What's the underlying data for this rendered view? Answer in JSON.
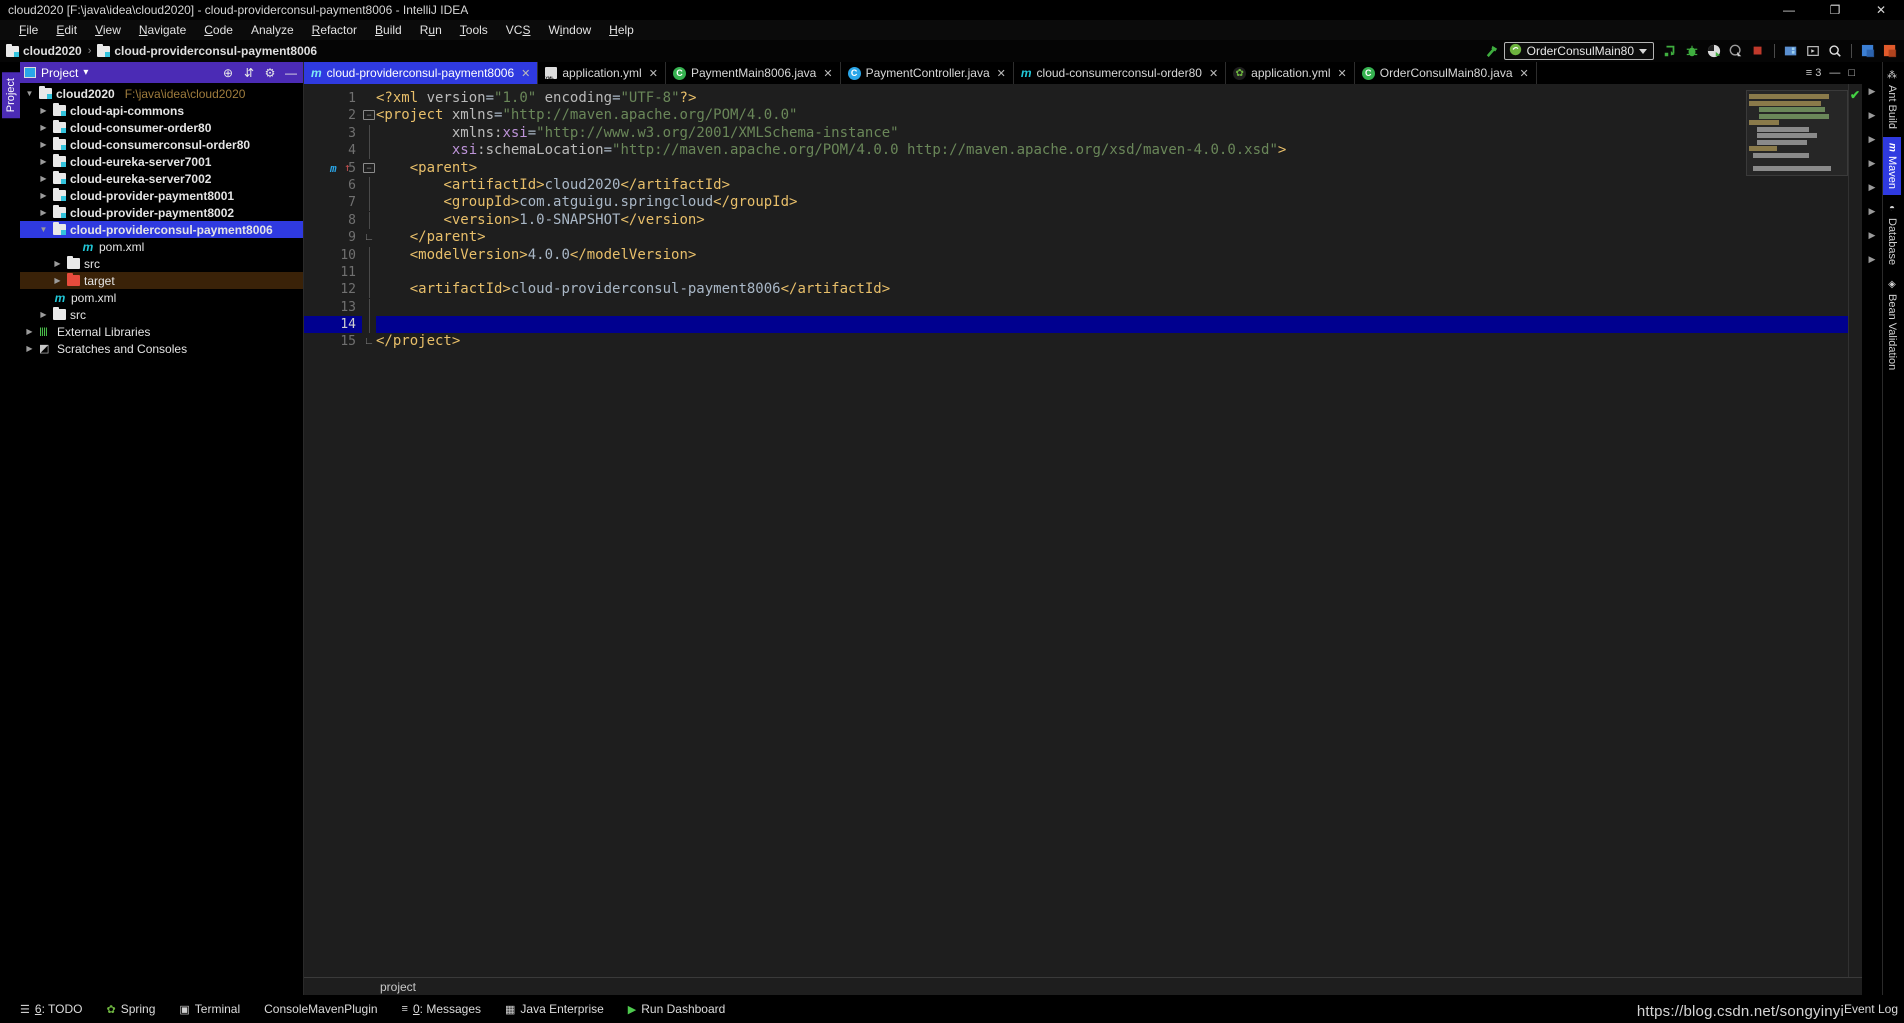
{
  "window": {
    "title": "cloud2020 [F:\\java\\idea\\cloud2020] - cloud-providerconsul-payment8006 - IntelliJ IDEA",
    "minimize": "—",
    "maximize": "❐",
    "close": "✕"
  },
  "menu": {
    "items": [
      {
        "label": "File"
      },
      {
        "label": "Edit"
      },
      {
        "label": "View"
      },
      {
        "label": "Navigate"
      },
      {
        "label": "Code"
      },
      {
        "label": "Analyze"
      },
      {
        "label": "Refactor"
      },
      {
        "label": "Build"
      },
      {
        "label": "Run"
      },
      {
        "label": "Tools"
      },
      {
        "label": "VCS"
      },
      {
        "label": "Window"
      },
      {
        "label": "Help"
      }
    ]
  },
  "navbar": {
    "breadcrumb": [
      {
        "label": "cloud2020",
        "icon": "module-folder-icon"
      },
      {
        "label": "cloud-providerconsul-payment8006",
        "icon": "module-folder-icon"
      }
    ],
    "separator": "›",
    "run_config": {
      "name": "OrderConsulMain80",
      "icon": "spring-boot-icon"
    },
    "actions": [
      {
        "name": "hammer-build-icon",
        "glyph": "↖"
      },
      {
        "name": "run-icon",
        "glyph": "▶"
      },
      {
        "name": "debug-icon",
        "glyph": "ὁE"
      },
      {
        "name": "run-coverage-icon",
        "glyph": "◐"
      },
      {
        "name": "profile-icon",
        "glyph": "◔"
      },
      {
        "name": "stop-icon",
        "glyph": "■"
      },
      {
        "name": "update-project-icon",
        "glyph": "▣"
      },
      {
        "name": "commit-icon",
        "glyph": "▷"
      },
      {
        "name": "search-everywhere-icon",
        "glyph": "⌕"
      },
      {
        "name": "vcs-history-icon",
        "glyph": "⧉"
      },
      {
        "name": "vcs-rollback-icon",
        "glyph": "↺"
      }
    ]
  },
  "project_panel": {
    "title": "Project",
    "dropdown_caret": "▾",
    "header_actions": [
      {
        "name": "locate-icon",
        "glyph": "⊕"
      },
      {
        "name": "collapse-all-icon",
        "glyph": "⇵"
      },
      {
        "name": "settings-gear-icon",
        "glyph": "⚙"
      },
      {
        "name": "hide-icon",
        "glyph": "—"
      }
    ],
    "side_tab": "Project",
    "tree": [
      {
        "label": "cloud2020",
        "path": "F:\\java\\idea\\cloud2020",
        "indent": 0,
        "arrow": "▼",
        "icon": "module-folder-icon",
        "state": "normal",
        "bold": true
      },
      {
        "label": "cloud-api-commons",
        "path": "",
        "indent": 1,
        "arrow": "▶",
        "icon": "module-folder-icon",
        "state": "normal",
        "bold": true
      },
      {
        "label": "cloud-consumer-order80",
        "path": "",
        "indent": 1,
        "arrow": "▶",
        "icon": "module-folder-icon",
        "state": "normal",
        "bold": true
      },
      {
        "label": "cloud-consumerconsul-order80",
        "path": "",
        "indent": 1,
        "arrow": "▶",
        "icon": "module-folder-icon",
        "state": "normal",
        "bold": true
      },
      {
        "label": "cloud-eureka-server7001",
        "path": "",
        "indent": 1,
        "arrow": "▶",
        "icon": "module-folder-icon",
        "state": "normal",
        "bold": true
      },
      {
        "label": "cloud-eureka-server7002",
        "path": "",
        "indent": 1,
        "arrow": "▶",
        "icon": "module-folder-icon",
        "state": "normal",
        "bold": true
      },
      {
        "label": "cloud-provider-payment8001",
        "path": "",
        "indent": 1,
        "arrow": "▶",
        "icon": "module-folder-icon",
        "state": "normal",
        "bold": true
      },
      {
        "label": "cloud-provider-payment8002",
        "path": "",
        "indent": 1,
        "arrow": "▶",
        "icon": "module-folder-icon",
        "state": "normal",
        "bold": true
      },
      {
        "label": "cloud-providerconsul-payment8006",
        "path": "",
        "indent": 1,
        "arrow": "▼",
        "icon": "module-folder-icon",
        "state": "selected",
        "bold": true
      },
      {
        "label": "pom.xml",
        "path": "",
        "indent": 3,
        "arrow": "",
        "icon": "maven-file-icon",
        "state": "normal",
        "bold": false
      },
      {
        "label": "src",
        "path": "",
        "indent": 2,
        "arrow": "▶",
        "icon": "folder-icon",
        "state": "normal",
        "bold": false
      },
      {
        "label": "target",
        "path": "",
        "indent": 2,
        "arrow": "▶",
        "icon": "excluded-folder-icon",
        "state": "warn",
        "bold": false
      },
      {
        "label": "pom.xml",
        "path": "",
        "indent": 1,
        "arrow": "",
        "icon": "maven-file-icon",
        "state": "normal",
        "bold": false
      },
      {
        "label": "src",
        "path": "",
        "indent": 1,
        "arrow": "▶",
        "icon": "folder-icon",
        "state": "normal",
        "bold": false
      },
      {
        "label": "External Libraries",
        "path": "",
        "indent": 0,
        "arrow": "▶",
        "icon": "libraries-icon",
        "state": "normal",
        "bold": false
      },
      {
        "label": "Scratches and Consoles",
        "path": "",
        "indent": 0,
        "arrow": "▶",
        "icon": "scratches-icon",
        "state": "normal",
        "bold": false
      }
    ]
  },
  "editor": {
    "tabs": [
      {
        "label": "cloud-providerconsul-payment8006",
        "icon": "maven-file-icon",
        "active": true,
        "close": "✕"
      },
      {
        "label": "application.yml",
        "icon": "yml-file-icon",
        "active": false,
        "close": "✕"
      },
      {
        "label": "PaymentMain8006.java",
        "icon": "spring-class-icon",
        "active": false,
        "close": "✕"
      },
      {
        "label": "PaymentController.java",
        "icon": "controller-class-icon",
        "active": false,
        "close": "✕"
      },
      {
        "label": "cloud-consumerconsul-order80",
        "icon": "maven-file-icon",
        "active": false,
        "close": "✕"
      },
      {
        "label": "application.yml",
        "icon": "spring-yml-icon",
        "active": false,
        "close": "✕"
      },
      {
        "label": "OrderConsulMain80.java",
        "icon": "spring-class-icon",
        "active": false,
        "close": "✕"
      }
    ],
    "tabs_overflow": "≡ 3",
    "tab_actions": [
      {
        "name": "hide-tabs-icon",
        "glyph": "—"
      },
      {
        "name": "restore-tabs-icon",
        "glyph": "□"
      }
    ],
    "breadcrumb": "project",
    "cursor_line": 14,
    "inspection_status": "ok",
    "gutter_marker_line": 5,
    "lines": [
      {
        "n": 1,
        "fold": "",
        "segs": [
          {
            "t": "<?xml ",
            "c": "tag"
          },
          {
            "t": "version",
            "c": "attr"
          },
          {
            "t": "=",
            "c": "txt"
          },
          {
            "t": "\"1.0\"",
            "c": "val"
          },
          {
            "t": " ",
            "c": "txt"
          },
          {
            "t": "encoding",
            "c": "attr"
          },
          {
            "t": "=",
            "c": "txt"
          },
          {
            "t": "\"UTF-8\"",
            "c": "val"
          },
          {
            "t": "?>",
            "c": "tag"
          }
        ]
      },
      {
        "n": 2,
        "fold": "minus",
        "segs": [
          {
            "t": "<project ",
            "c": "tag"
          },
          {
            "t": "xmlns",
            "c": "attr"
          },
          {
            "t": "=",
            "c": "txt"
          },
          {
            "t": "\"http://maven.apache.org/POM/4.0.0\"",
            "c": "val"
          }
        ]
      },
      {
        "n": 3,
        "fold": "bar",
        "segs": [
          {
            "t": "         ",
            "c": "txt"
          },
          {
            "t": "xmlns:",
            "c": "attr"
          },
          {
            "t": "xsi",
            "c": "attrns"
          },
          {
            "t": "=",
            "c": "txt"
          },
          {
            "t": "\"http://www.w3.org/2001/XMLSchema-instance\"",
            "c": "val"
          }
        ]
      },
      {
        "n": 4,
        "fold": "bar",
        "segs": [
          {
            "t": "         ",
            "c": "txt"
          },
          {
            "t": "xsi",
            "c": "attrns"
          },
          {
            "t": ":schemaLocation",
            "c": "attr"
          },
          {
            "t": "=",
            "c": "txt"
          },
          {
            "t": "\"http://maven.apache.org/POM/4.0.0 http://maven.apache.org/xsd/maven-4.0.0.xsd\"",
            "c": "val"
          },
          {
            "t": ">",
            "c": "tag"
          }
        ]
      },
      {
        "n": 5,
        "fold": "minus",
        "segs": [
          {
            "t": "    ",
            "c": "txt"
          },
          {
            "t": "<parent>",
            "c": "tag"
          }
        ]
      },
      {
        "n": 6,
        "fold": "bar",
        "segs": [
          {
            "t": "        ",
            "c": "txt"
          },
          {
            "t": "<artifactId>",
            "c": "tag"
          },
          {
            "t": "cloud2020",
            "c": "txt"
          },
          {
            "t": "</artifactId>",
            "c": "tag"
          }
        ]
      },
      {
        "n": 7,
        "fold": "bar",
        "segs": [
          {
            "t": "        ",
            "c": "txt"
          },
          {
            "t": "<groupId>",
            "c": "tag"
          },
          {
            "t": "com.atguigu.springcloud",
            "c": "txt"
          },
          {
            "t": "</groupId>",
            "c": "tag"
          }
        ]
      },
      {
        "n": 8,
        "fold": "bar",
        "segs": [
          {
            "t": "        ",
            "c": "txt"
          },
          {
            "t": "<version>",
            "c": "tag"
          },
          {
            "t": "1.0-SNAPSHOT",
            "c": "txt"
          },
          {
            "t": "</version>",
            "c": "tag"
          }
        ]
      },
      {
        "n": 9,
        "fold": "end",
        "segs": [
          {
            "t": "    ",
            "c": "txt"
          },
          {
            "t": "</parent>",
            "c": "tag"
          }
        ]
      },
      {
        "n": 10,
        "fold": "bar",
        "segs": [
          {
            "t": "    ",
            "c": "txt"
          },
          {
            "t": "<modelVersion>",
            "c": "tag"
          },
          {
            "t": "4.0.0",
            "c": "txt"
          },
          {
            "t": "</modelVersion>",
            "c": "tag"
          }
        ]
      },
      {
        "n": 11,
        "fold": "bar",
        "segs": []
      },
      {
        "n": 12,
        "fold": "bar",
        "segs": [
          {
            "t": "    ",
            "c": "txt"
          },
          {
            "t": "<artifactId>",
            "c": "tag"
          },
          {
            "t": "cloud-providerconsul-payment8006",
            "c": "txt"
          },
          {
            "t": "</artifactId>",
            "c": "tag"
          }
        ]
      },
      {
        "n": 13,
        "fold": "bar",
        "segs": []
      },
      {
        "n": 14,
        "fold": "bar",
        "segs": []
      },
      {
        "n": 15,
        "fold": "end",
        "segs": [
          {
            "t": "</project>",
            "c": "tag"
          }
        ]
      }
    ]
  },
  "right_strip": {
    "tabs": [
      {
        "label": "Ant Build",
        "icon": "ant-icon",
        "active": false
      },
      {
        "label": "Maven",
        "icon": "maven-icon",
        "active": true
      },
      {
        "label": "Database",
        "icon": "database-icon",
        "active": false
      },
      {
        "label": "Bean Validation",
        "icon": "bean-validation-icon",
        "active": false
      }
    ]
  },
  "statusbar": {
    "items": [
      {
        "label": "6: TODO",
        "icon": "todo-icon",
        "mnemonic": "6"
      },
      {
        "label": "Spring",
        "icon": "spring-leaf-icon",
        "mnemonic": ""
      },
      {
        "label": "Terminal",
        "icon": "terminal-icon",
        "mnemonic": ""
      },
      {
        "label": "ConsoleMavenPlugin",
        "icon": "",
        "mnemonic": ""
      },
      {
        "label": "0: Messages",
        "icon": "messages-icon",
        "mnemonic": "0"
      },
      {
        "label": "Java Enterprise",
        "icon": "java-enterprise-icon",
        "mnemonic": ""
      },
      {
        "label": "Run Dashboard",
        "icon": "run-dashboard-icon",
        "mnemonic": ""
      }
    ],
    "event_log": "Event Log",
    "watermark": "https://blog.csdn.net/songyinyi"
  },
  "colors": {
    "accent_purple": "#4b2bb5",
    "accent_blue": "#2f3ae0",
    "tag": "#e8bf6a",
    "value": "#6a8759",
    "namespace": "#bd93d8",
    "cursor_line": "#00008f",
    "warn_row": "#3a2208",
    "path_text": "#9e7b3c"
  }
}
